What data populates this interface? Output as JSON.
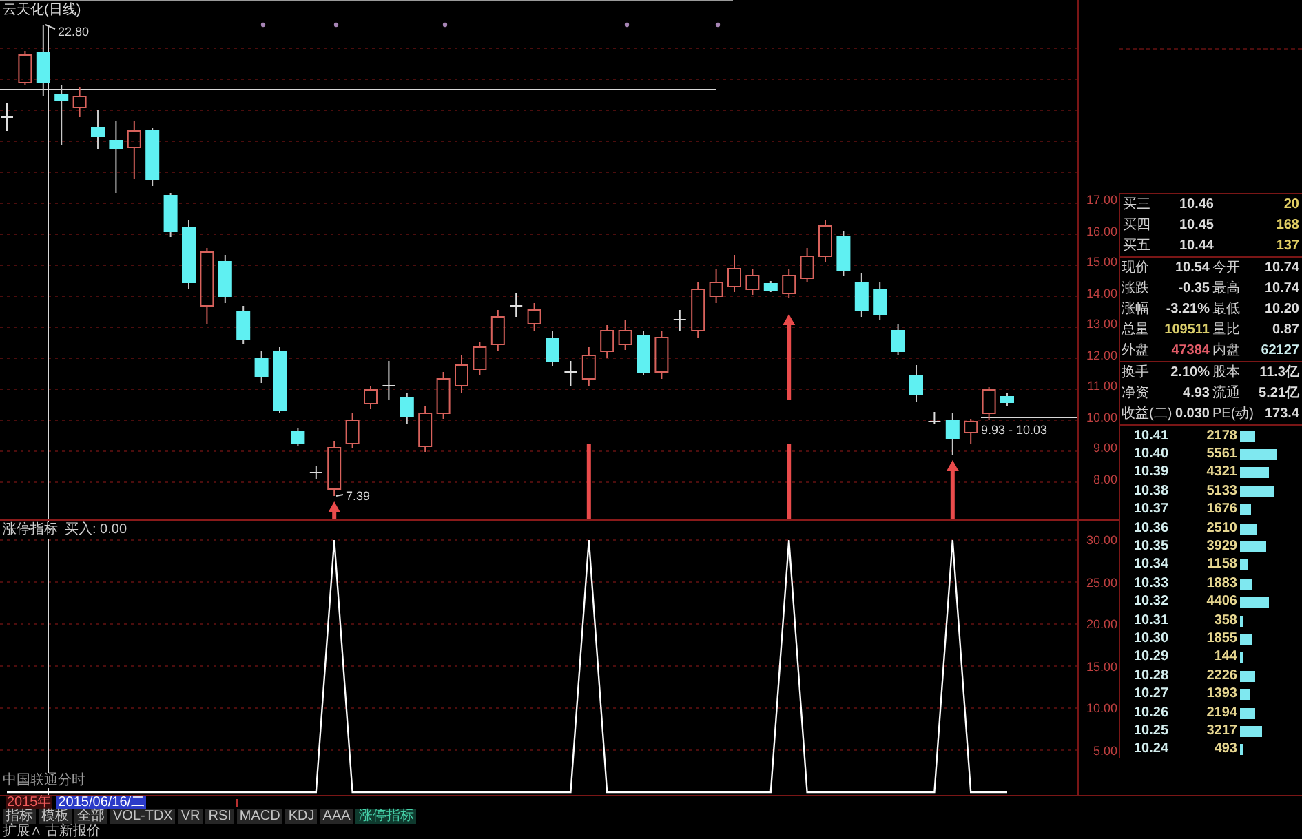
{
  "main_chart": {
    "title": "云天化(日线)",
    "high_label": "22.80",
    "low_label": "7.39",
    "range_label": "9.93 - 10.03",
    "axis_labels": [
      "17.00",
      "16.00",
      "15.00",
      "14.00",
      "13.00",
      "12.00",
      "11.00",
      "10.00",
      "9.00",
      "8.00"
    ]
  },
  "indicator": {
    "title": "涨停指标",
    "reading": "买入: 0.00",
    "status_text": "中国联通分时",
    "chart_data": {
      "type": "line",
      "grid": true,
      "ylim": [
        0,
        30
      ],
      "yticks": [
        {
          "value": 30,
          "label": "30.00"
        },
        {
          "value": 25,
          "label": "25.00"
        },
        {
          "value": 20,
          "label": "20.00"
        },
        {
          "value": 15,
          "label": "15.00"
        },
        {
          "value": 10,
          "label": "10.00"
        },
        {
          "value": 5,
          "label": "5.00"
        }
      ],
      "series": [
        {
          "color": "#ffffff",
          "values": [
            0,
            0,
            0,
            0,
            0,
            0,
            0,
            0,
            0,
            0,
            0,
            0,
            0,
            0,
            0,
            0,
            0,
            0,
            30,
            0,
            0,
            0,
            0,
            0,
            0,
            0,
            0,
            0,
            0,
            0,
            0,
            0,
            30,
            0,
            0,
            0,
            0,
            0,
            0,
            0,
            0,
            0,
            0,
            30,
            0,
            0,
            0,
            0,
            0,
            0,
            0,
            0,
            30,
            0,
            0,
            0
          ]
        }
      ]
    }
  },
  "quote": {
    "bids": [
      {
        "label": "买三",
        "price": "10.46",
        "volume": "20"
      },
      {
        "label": "买四",
        "price": "10.45",
        "volume": "168"
      },
      {
        "label": "买五",
        "price": "10.44",
        "volume": "137"
      }
    ],
    "stats": [
      {
        "label": "现价",
        "value": "10.54",
        "color": "#dcdcdc"
      },
      {
        "label": "今开",
        "value": "10.74",
        "color": "#dcdcdc"
      },
      {
        "label": "涨跌",
        "value": "-0.35",
        "color": "#dcdcdc"
      },
      {
        "label": "最高",
        "value": "10.74",
        "color": "#dcdcdc"
      },
      {
        "label": "涨幅",
        "value": "-3.21%",
        "color": "#dcdcdc"
      },
      {
        "label": "最低",
        "value": "10.20",
        "color": "#dcdcdc"
      },
      {
        "label": "总量",
        "value": "109511",
        "color": "#d8cc6a"
      },
      {
        "label": "量比",
        "value": "0.87",
        "color": "#dcdcdc"
      },
      {
        "label": "外盘",
        "value": "47384",
        "color": "#e25c68"
      },
      {
        "label": "内盘",
        "value": "62127",
        "color": "#cdeeee"
      }
    ],
    "stats_2": [
      {
        "label": "换手",
        "value": "2.10%"
      },
      {
        "label": "股本",
        "value": "11.3亿"
      },
      {
        "label": "净资",
        "value": "4.93"
      },
      {
        "label": "流通",
        "value": "5.21亿"
      },
      {
        "label": "收益(二)",
        "value": "0.030"
      },
      {
        "label": "PE(动)",
        "value": "173.4"
      }
    ],
    "book": [
      {
        "price": "10.41",
        "volume": "2178"
      },
      {
        "price": "10.40",
        "volume": "5561"
      },
      {
        "price": "10.39",
        "volume": "4321"
      },
      {
        "price": "10.38",
        "volume": "5133"
      },
      {
        "price": "10.37",
        "volume": "1676"
      },
      {
        "price": "10.36",
        "volume": "2510"
      },
      {
        "price": "10.35",
        "volume": "3929"
      },
      {
        "price": "10.34",
        "volume": "1158"
      },
      {
        "price": "10.33",
        "volume": "1883"
      },
      {
        "price": "10.32",
        "volume": "4406"
      },
      {
        "price": "10.31",
        "volume": "358"
      },
      {
        "price": "10.30",
        "volume": "1855"
      },
      {
        "price": "10.29",
        "volume": "144"
      },
      {
        "price": "10.28",
        "volume": "2226"
      },
      {
        "price": "10.27",
        "volume": "1393"
      },
      {
        "price": "10.26",
        "volume": "2194"
      },
      {
        "price": "10.25",
        "volume": "3217"
      },
      {
        "price": "10.24",
        "volume": "493"
      }
    ]
  },
  "date_bar": {
    "year": "2015年",
    "date": "2015/06/16/二"
  },
  "tabs": [
    {
      "label": "指标",
      "selected": false
    },
    {
      "label": "模板",
      "selected": false
    },
    {
      "label": "全部",
      "selected": false
    },
    {
      "label": "VOL-TDX",
      "selected": false
    },
    {
      "label": "VR",
      "selected": false
    },
    {
      "label": "RSI",
      "selected": false
    },
    {
      "label": "MACD",
      "selected": false
    },
    {
      "label": "KDJ",
      "selected": false
    },
    {
      "label": "AAA",
      "selected": false
    },
    {
      "label": "涨停指标",
      "selected": true
    }
  ],
  "footer": "扩展∧ 古新报价"
}
